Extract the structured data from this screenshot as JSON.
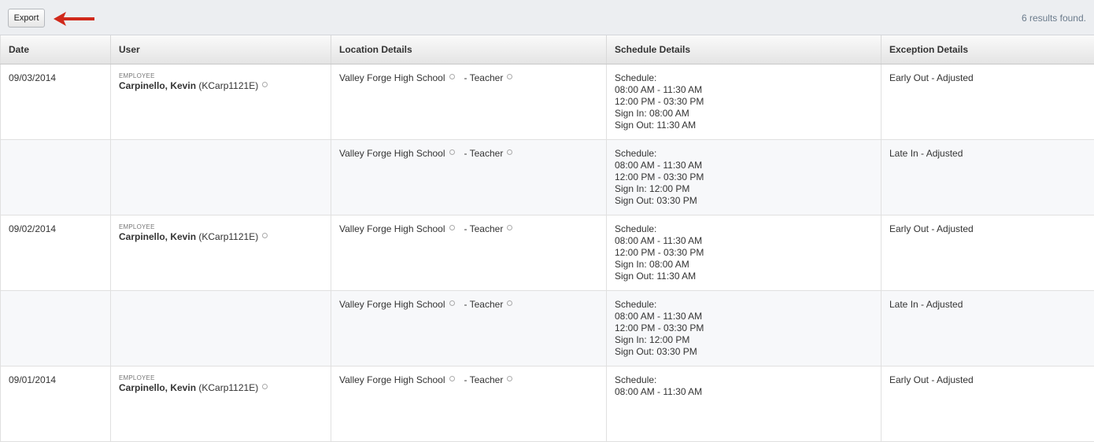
{
  "toolbar": {
    "export_label": "Export",
    "results_text": "6 results found."
  },
  "table": {
    "headers": [
      "Date",
      "User",
      "Location Details",
      "Schedule Details",
      "Exception Details"
    ],
    "rows": [
      {
        "date": "09/03/2014",
        "user_label": "EMPLOYEE",
        "user_name": "Carpinello, Kevin",
        "user_id": "(KCarp1121E)",
        "location": "Valley Forge High School",
        "role": "- Teacher",
        "schedule": [
          "Schedule:",
          "08:00 AM - 11:30 AM",
          "12:00 PM - 03:30 PM",
          "Sign In: 08:00 AM",
          "Sign Out: 11:30 AM"
        ],
        "exception": "Early Out - Adjusted"
      },
      {
        "date": "",
        "user_label": "",
        "user_name": "",
        "user_id": "",
        "location": "Valley Forge High School",
        "role": "- Teacher",
        "schedule": [
          "Schedule:",
          "08:00 AM - 11:30 AM",
          "12:00 PM - 03:30 PM",
          "Sign In: 12:00 PM",
          "Sign Out: 03:30 PM"
        ],
        "exception": "Late In - Adjusted"
      },
      {
        "date": "09/02/2014",
        "user_label": "EMPLOYEE",
        "user_name": "Carpinello, Kevin",
        "user_id": "(KCarp1121E)",
        "location": "Valley Forge High School",
        "role": "- Teacher",
        "schedule": [
          "Schedule:",
          "08:00 AM - 11:30 AM",
          "12:00 PM - 03:30 PM",
          "Sign In: 08:00 AM",
          "Sign Out: 11:30 AM"
        ],
        "exception": "Early Out - Adjusted"
      },
      {
        "date": "",
        "user_label": "",
        "user_name": "",
        "user_id": "",
        "location": "Valley Forge High School",
        "role": "- Teacher",
        "schedule": [
          "Schedule:",
          "08:00 AM - 11:30 AM",
          "12:00 PM - 03:30 PM",
          "Sign In: 12:00 PM",
          "Sign Out: 03:30 PM"
        ],
        "exception": "Late In - Adjusted"
      },
      {
        "date": "09/01/2014",
        "user_label": "EMPLOYEE",
        "user_name": "Carpinello, Kevin",
        "user_id": "(KCarp1121E)",
        "location": "Valley Forge High School",
        "role": "- Teacher",
        "schedule": [
          "Schedule:",
          "08:00 AM - 11:30 AM"
        ],
        "exception": "Early Out - Adjusted"
      }
    ]
  },
  "colors": {
    "arrow": "#d0291b",
    "toolbar_bg": "#eceef1",
    "results_text": "#6b7b8c"
  }
}
